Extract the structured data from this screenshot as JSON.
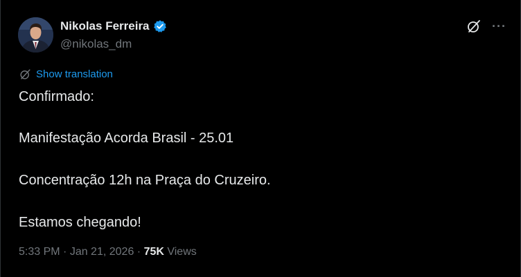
{
  "author": {
    "name": "Nikolas Ferreira",
    "handle": "@nikolas_dm"
  },
  "actions": {
    "grok_icon": "grok-icon",
    "more_label": "···"
  },
  "translation": {
    "label": "Show translation",
    "icon": "translate-icon"
  },
  "tweet": {
    "lines": [
      "Confirmado:",
      "Manifestação Acorda Brasil - 25.01",
      "Concentração 12h na Praça do Cruzeiro.",
      "Estamos chegando!"
    ]
  },
  "meta": {
    "time": "5:33 PM",
    "separator": " · ",
    "date": "Jan 21, 2026",
    "views_count": "75K",
    "views_label": " Views"
  },
  "colors": {
    "background": "#000000",
    "text": "#e7e9ea",
    "muted": "#71767b",
    "accent": "#1d9bf0"
  }
}
